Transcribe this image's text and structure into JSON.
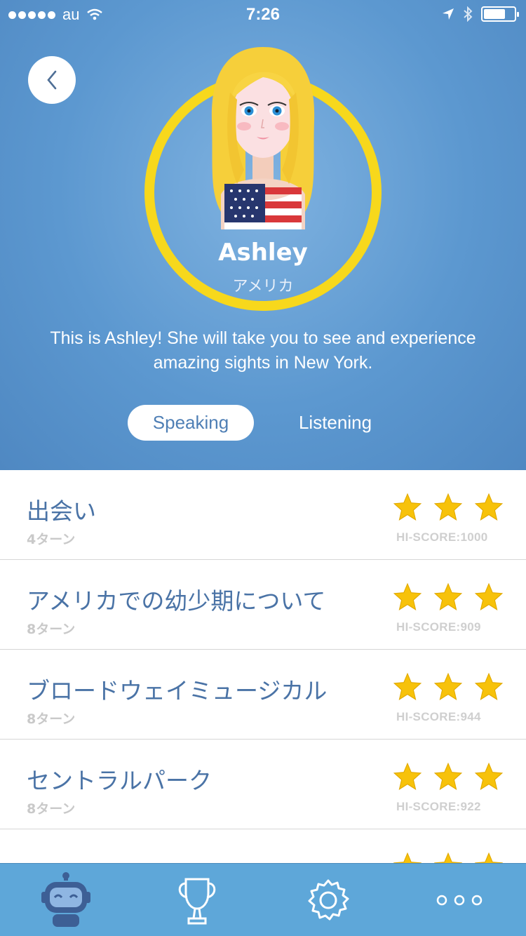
{
  "status_bar": {
    "carrier": "au",
    "time": "7:26"
  },
  "character": {
    "name": "Ashley",
    "country": "アメリカ",
    "description": "This is Ashley! She will take you to see and experience amazing sights in New York."
  },
  "tabs": {
    "speaking": "Speaking",
    "listening": "Listening",
    "selected": "Speaking"
  },
  "lessons": [
    {
      "title": "出会い",
      "turns": "4ターン",
      "stars": 3,
      "score": "HI-SCORE:1000"
    },
    {
      "title": "アメリカでの幼少期について",
      "turns": "8ターン",
      "stars": 3,
      "score": "HI-SCORE:909"
    },
    {
      "title": "ブロードウェイミュージカル",
      "turns": "8ターン",
      "stars": 3,
      "score": "HI-SCORE:944"
    },
    {
      "title": "セントラルパーク",
      "turns": "8ターン",
      "stars": 3,
      "score": "HI-SCORE:922"
    },
    {
      "title": "",
      "turns": "",
      "stars": 3,
      "score": ""
    }
  ],
  "tabbar": {
    "items": [
      "robot-icon",
      "trophy-icon",
      "gear-icon",
      "more-icon"
    ],
    "active": "robot-icon"
  },
  "colors": {
    "accent": "#4f88c2",
    "ring": "#f7d81c",
    "title_text": "#4a73a6",
    "tabbar": "#5ea7d9",
    "star": "#f7c20a"
  }
}
